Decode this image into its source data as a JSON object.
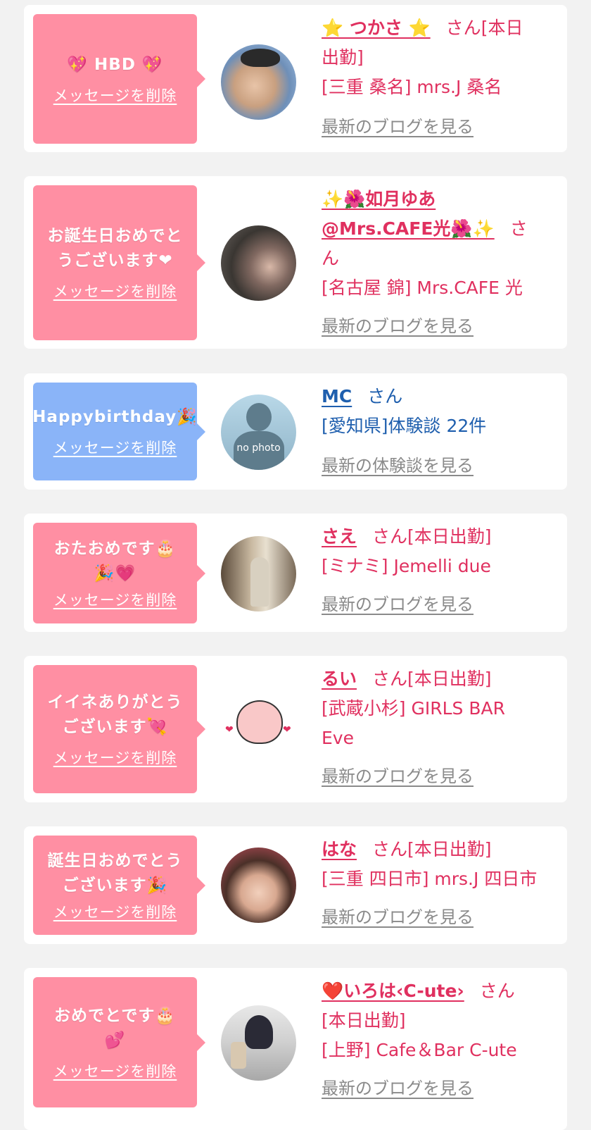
{
  "delete_label": "メッセージを削除",
  "san": "さん",
  "cards": [
    {
      "message_lines": [
        "💖 HBD 💖"
      ],
      "name": "⭐ つかさ ⭐",
      "status_inline": "[本日",
      "status_cont": "出勤]",
      "shop": "[三重 桑名] mrs.J 桑名",
      "blog": "最新のブログを見る"
    },
    {
      "message_lines": [
        "お誕生日おめでと",
        "うございます❤"
      ],
      "name_lines": [
        "✨🌺如月ゆあ",
        "@Mrs.CAFE光🌺✨"
      ],
      "san_cont": "ん",
      "shop": "[名古屋 錦] Mrs.CAFE 光",
      "blog": "最新のブログを見る"
    },
    {
      "message_lines": [
        "Happybirthday🎉"
      ],
      "name": "MC",
      "avatar_text": "no photo",
      "shop": "[愛知県]体験談 22件",
      "blog": "最新の体験談を見る"
    },
    {
      "message_lines": [
        "おたおめです🎂",
        "🎉💗"
      ],
      "name": "さえ",
      "status": "[本日出勤]",
      "shop": "[ミナミ] Jemelli due",
      "blog": "最新のブログを見る"
    },
    {
      "message_lines": [
        "イイネありがとう",
        "ございます💘"
      ],
      "name": "るい",
      "status": "[本日出勤]",
      "shop_lines": [
        "[武蔵小杉] GIRLS BAR",
        "Eve"
      ],
      "blog": "最新のブログを見る"
    },
    {
      "message_lines": [
        "誕生日おめでとう",
        "ございます🎉"
      ],
      "name": "はな",
      "status": "[本日出勤]",
      "shop": "[三重 四日市] mrs.J 四日市",
      "blog": "最新のブログを見る"
    },
    {
      "message_lines": [
        "おめでとです🎂",
        "💕"
      ],
      "name": "❤️いろは‹C-ute›",
      "status": "[本日出勤]",
      "shop": "[上野] Cafe＆Bar C-ute",
      "blog": "最新のブログを見る"
    }
  ]
}
